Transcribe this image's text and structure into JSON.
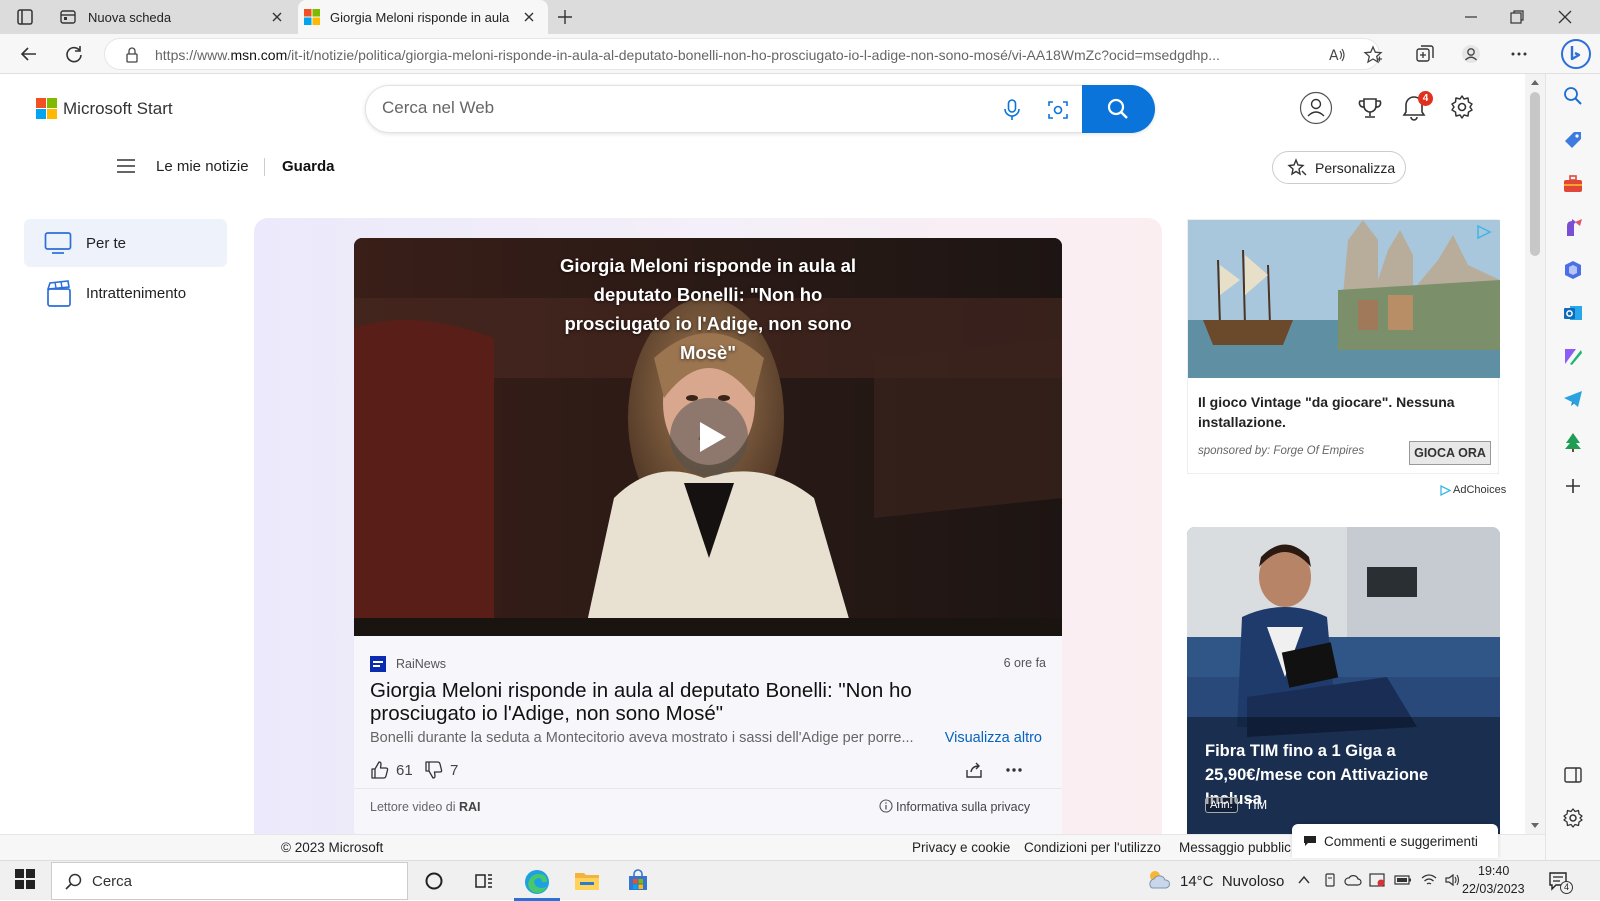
{
  "browser": {
    "tabs": [
      {
        "title": "Nuova scheda",
        "active": false,
        "icon": "new-tab-icon"
      },
      {
        "title": "Giorgia Meloni risponde in aula a",
        "active": true,
        "icon": "microsoft-logo-icon"
      }
    ],
    "url_prefix": "https://www.",
    "url_domain": "msn.com",
    "url_path": "/it-it/notizie/politica/giorgia-meloni-risponde-in-aula-al-deputato-bonelli-non-ho-prosciugato-io-l-adige-non-sono-mosé/vi-AA18WmZc?ocid=msedgdhp..."
  },
  "header": {
    "brand": "Microsoft Start",
    "search_placeholder": "Cerca nel Web",
    "notifications_count": "4"
  },
  "nav": {
    "my_news": "Le mie notizie",
    "watch": "Guarda",
    "personalize": "Personalizza"
  },
  "left_nav": {
    "items": [
      {
        "label": "Per te",
        "icon": "tv-icon",
        "active": true
      },
      {
        "label": "Intrattenimento",
        "icon": "clapperboard-icon",
        "active": false
      }
    ]
  },
  "video_card": {
    "overlay_title": "Giorgia Meloni risponde in aula al deputato Bonelli: \"Non ho prosciugato io l'Adige, non sono Mosè\"",
    "source": "RaiNews",
    "time": "6 ore fa",
    "headline": "Giorgia Meloni risponde in aula al deputato Bonelli: \"Non ho prosciugato io l'Adige, non sono Mosé\"",
    "abstract": "Bonelli durante la seduta a Montecitorio aveva mostrato i sassi dell'Adige per porre...",
    "see_more": "Visualizza altro",
    "likes": "61",
    "dislikes": "7",
    "player_label": "Lettore video di ",
    "player_brand": "RAI",
    "privacy": "Informativa sulla privacy"
  },
  "ads": {
    "ad1_title": "Il gioco Vintage \"da giocare\". Nessuna installazione.",
    "ad1_sponsor": "sponsored by: Forge Of Empires",
    "ad1_cta": "GIOCA ORA",
    "adchoices": "AdChoices",
    "ad2_title": "Fibra TIM fino a 1 Giga a 25,90€/mese con Attivazione Inclusa",
    "ad2_badge": "Ann.",
    "ad2_brand": "TIM"
  },
  "footer": {
    "copyright": "© 2023 Microsoft",
    "privacy": "Privacy e cookie",
    "terms": "Condizioni per l'utilizzo",
    "ads": "Messaggio pubblic",
    "feedback": "Commenti e suggerimenti"
  },
  "taskbar": {
    "search": "Cerca",
    "weather": "14°C  Nuvoloso",
    "time": "19:40",
    "date": "22/03/2023",
    "notif_count": "4"
  },
  "colors": {
    "accent": "#0a74da",
    "link": "#0563c1",
    "feed_bg_left": "#ebe9fb",
    "feed_bg_right": "#fbeef1"
  }
}
